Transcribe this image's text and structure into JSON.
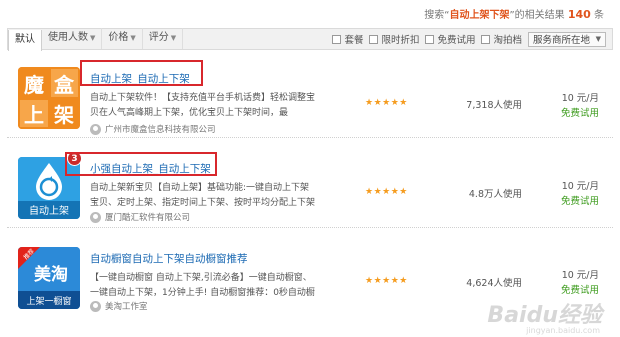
{
  "summary": {
    "prefix": "搜索“",
    "keyword": "自动上架下架",
    "middle": "”的相关结果",
    "count": "140",
    "suffix": "条"
  },
  "filterbar": {
    "tabs": [
      {
        "label": "默认",
        "has_arrow": false,
        "active": true
      },
      {
        "label": "使用人数",
        "has_arrow": true,
        "active": false
      },
      {
        "label": "价格",
        "has_arrow": true,
        "active": false
      },
      {
        "label": "评分",
        "has_arrow": true,
        "active": false
      }
    ],
    "checkboxes": [
      "套餐",
      "限时折扣",
      "免费试用",
      "淘拍档"
    ],
    "dropdown_label": "服务商所在地"
  },
  "results": [
    {
      "title": "自动上架_自动上下架",
      "desc": "自动上下架软件！【支持充值平台手机话费】轻松调整宝贝在人气高峰期上下架，优化宝贝上下架时间，最",
      "vendor": "广州市魔盒信息科技有限公司",
      "stars": "★★★★★",
      "users": "7,318人使用",
      "price": "10 元/月",
      "trial": "免费试用",
      "logo_text_a": "魔",
      "logo_text_b": "盒",
      "logo_text_c": "上",
      "logo_text_d": "架"
    },
    {
      "title": "小强自动上架_自动上下架",
      "badge": "3",
      "desc": "自动上架新宝贝【自动上架】基础功能:一键自动上下架宝贝、定时上架、指定时间上下架、按时平均分配上下架",
      "vendor": "厦门酷汇软件有限公司",
      "stars": "★★★★★",
      "users": "4.8万人使用",
      "price": "10 元/月",
      "trial": "免费试用",
      "logo_text": "自动上架"
    },
    {
      "title": "自动橱窗自动上下架自动橱窗推荐",
      "desc": "【一键自动橱窗 自动上下架,引流必备】一键自动橱窗、一键自动上下架，1分钟上手! 自动橱窗推荐：0秒自动橱",
      "vendor": "美淘工作室",
      "stars": "★★★★★",
      "users": "4,624人使用",
      "price": "10 元/月",
      "trial": "免费试用",
      "logo_tag": "推荐",
      "logo_text_a": "美淘",
      "logo_text_b": "上架一橱窗"
    }
  ],
  "watermark": {
    "main": "Baidu经验",
    "sub": "jingyan.baidu.com"
  },
  "colors": {
    "link": "#1c6ab3",
    "highlight": "#e0541d",
    "free": "#3c9b1c",
    "star": "#f59c1f",
    "annotation": "#d8272c"
  }
}
